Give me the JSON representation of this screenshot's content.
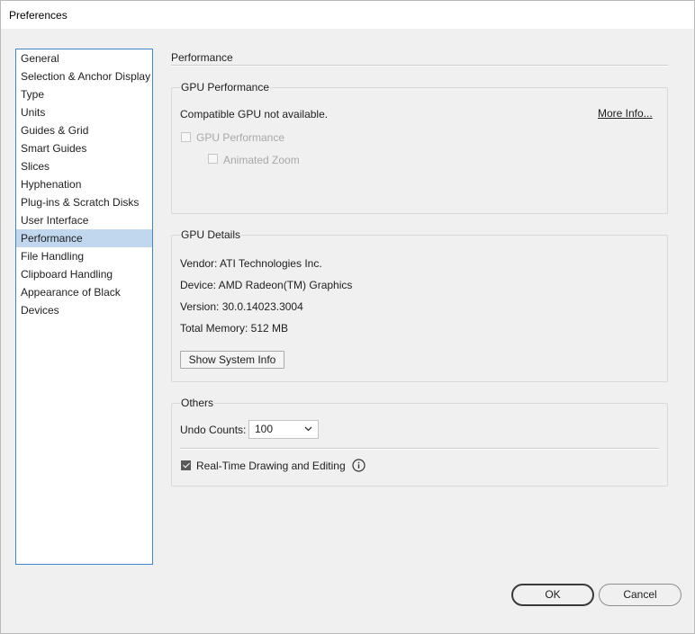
{
  "window": {
    "title": "Preferences"
  },
  "sidebar": {
    "items": [
      {
        "label": "General"
      },
      {
        "label": "Selection & Anchor Display"
      },
      {
        "label": "Type"
      },
      {
        "label": "Units"
      },
      {
        "label": "Guides & Grid"
      },
      {
        "label": "Smart Guides"
      },
      {
        "label": "Slices"
      },
      {
        "label": "Hyphenation"
      },
      {
        "label": "Plug-ins & Scratch Disks"
      },
      {
        "label": "User Interface"
      },
      {
        "label": "Performance"
      },
      {
        "label": "File Handling"
      },
      {
        "label": "Clipboard Handling"
      },
      {
        "label": "Appearance of Black"
      },
      {
        "label": "Devices"
      }
    ],
    "selected": "Performance"
  },
  "section": {
    "title": "Performance"
  },
  "gpu_performance": {
    "legend": "GPU Performance",
    "status": "Compatible GPU not available.",
    "more_info": "More Info...",
    "gpu_checkbox": {
      "label": "GPU Performance",
      "checked": false,
      "enabled": false
    },
    "zoom_checkbox": {
      "label": "Animated Zoom",
      "checked": false,
      "enabled": false
    }
  },
  "gpu_details": {
    "legend": "GPU Details",
    "vendor": "Vendor: ATI Technologies Inc.",
    "device": "Device: AMD Radeon(TM) Graphics",
    "version": "Version: 30.0.14023.3004",
    "memory": "Total Memory: 512 MB",
    "system_info_button": "Show System Info"
  },
  "others": {
    "legend": "Others",
    "undo_label": "Undo Counts:",
    "undo_value": "100",
    "realtime_checkbox": {
      "label": "Real-Time Drawing and Editing",
      "checked": true
    }
  },
  "footer": {
    "ok": "OK",
    "cancel": "Cancel"
  },
  "colors": {
    "selection": "#c1d7ee",
    "sidebar_border": "#3f87d1"
  },
  "icons": {
    "dropdown": "chevron-down-icon",
    "info": "info-icon"
  }
}
